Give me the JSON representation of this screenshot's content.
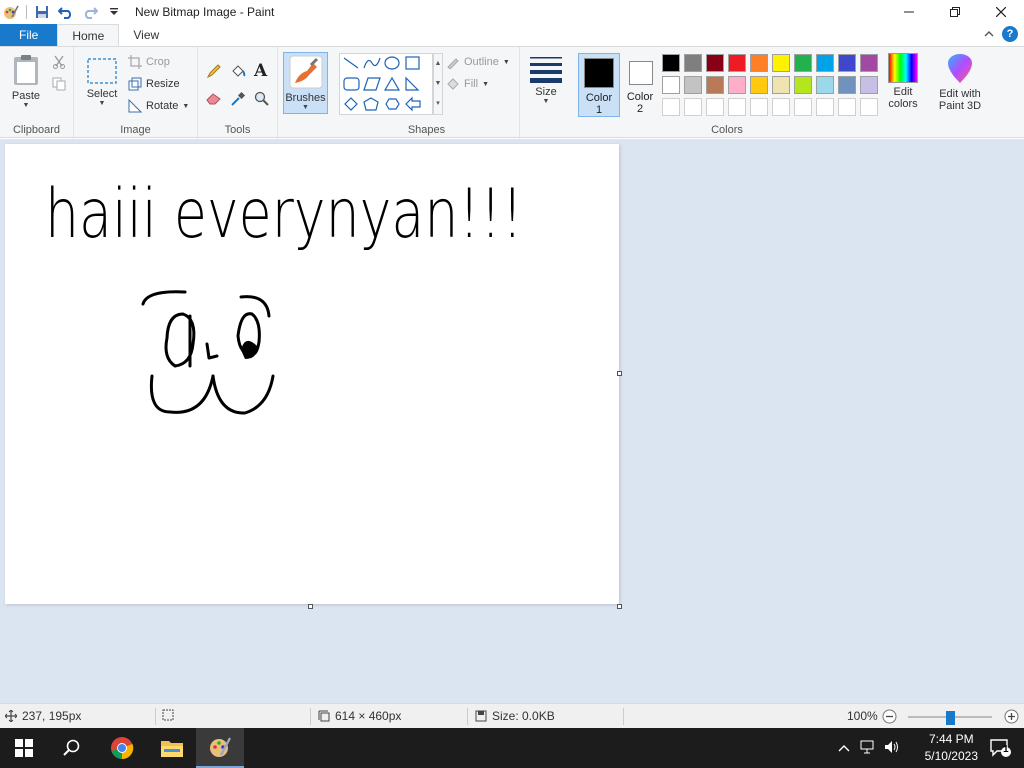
{
  "window": {
    "title": "New Bitmap Image - Paint"
  },
  "tabs": {
    "file": "File",
    "home": "Home",
    "view": "View"
  },
  "ribbon": {
    "clipboard": {
      "label": "Clipboard",
      "paste": "Paste"
    },
    "image": {
      "label": "Image",
      "select": "Select",
      "crop": "Crop",
      "resize": "Resize",
      "rotate": "Rotate"
    },
    "tools": {
      "label": "Tools"
    },
    "brushes": {
      "label": "Brushes"
    },
    "shapes": {
      "label": "Shapes",
      "outline": "Outline",
      "fill": "Fill"
    },
    "size": {
      "label": "Size"
    },
    "colors": {
      "label": "Colors",
      "color1": "Color 1",
      "color1_line1": "Color",
      "color1_line2": "1",
      "color2_line1": "Color",
      "color2_line2": "2",
      "edit_colors_line1": "Edit",
      "edit_colors_line2": "colors",
      "paint3d_line1": "Edit with",
      "paint3d_line2": "Paint 3D",
      "palette_row1": [
        "#000000",
        "#7f7f7f",
        "#880015",
        "#ed1c24",
        "#ff7f27",
        "#fff200",
        "#22b14c",
        "#00a2e8",
        "#3f48cc",
        "#a349a4"
      ],
      "palette_row2": [
        "#ffffff",
        "#c3c3c3",
        "#b97a57",
        "#ffaec9",
        "#ffc90e",
        "#efe4b0",
        "#b5e61d",
        "#99d9ea",
        "#7092be",
        "#c8bfe7"
      ],
      "selected_color1": "#000000",
      "selected_color2": "#ffffff"
    }
  },
  "canvas": {
    "handwritten_text": "haiii everynyan!!!"
  },
  "status": {
    "cursor_pos": "237, 195px",
    "canvas_size": "614 × 460px",
    "file_size": "Size: 0.0KB",
    "zoom": "100%"
  },
  "taskbar": {
    "time": "7:44 PM",
    "date": "5/10/2023",
    "notifications": "1"
  }
}
